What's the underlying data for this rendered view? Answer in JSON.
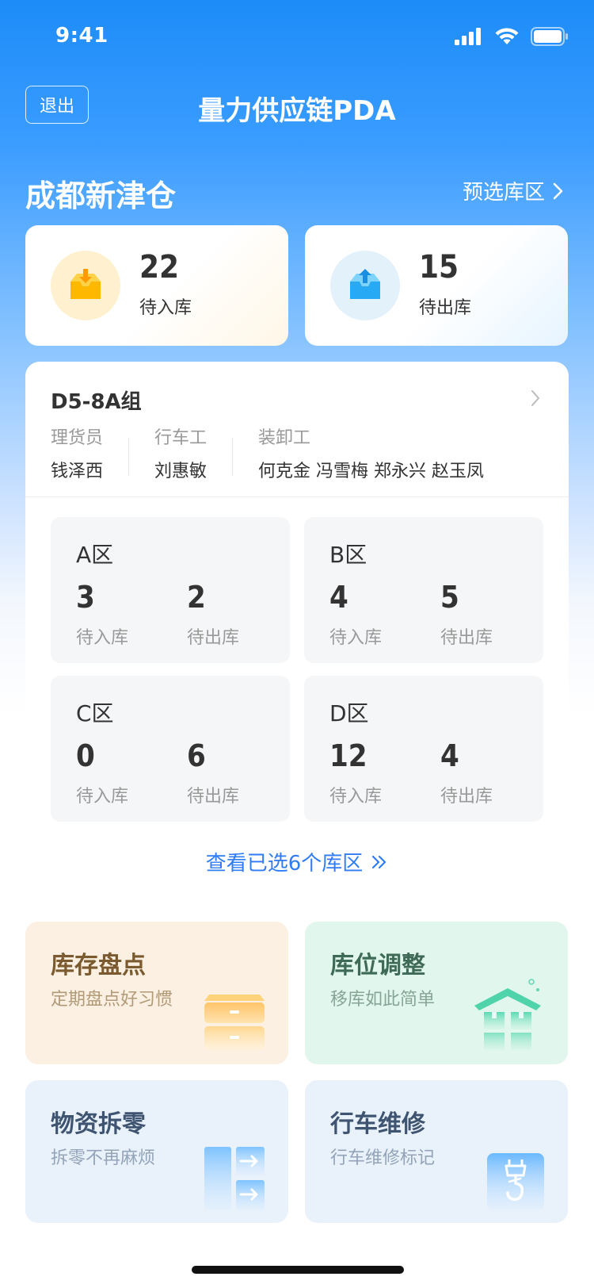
{
  "status_bar": {
    "time": "9:41"
  },
  "nav": {
    "exit_label": "退出",
    "title": "量力供应链PDA"
  },
  "warehouse": {
    "name": "成都新津仓",
    "preselect_label": "预选库区"
  },
  "summary": {
    "inbound": {
      "count": "22",
      "label": "待入库"
    },
    "outbound": {
      "count": "15",
      "label": "待出库"
    }
  },
  "group": {
    "title": "D5-8A组",
    "roles": [
      {
        "label": "理货员",
        "value": "钱泽西"
      },
      {
        "label": "行车工",
        "value": "刘惠敏"
      },
      {
        "label": "装卸工",
        "value": "何克金 冯雪梅 郑永兴 赵玉凤"
      }
    ],
    "zones": [
      {
        "name": "A区",
        "in": "3",
        "out": "2"
      },
      {
        "name": "B区",
        "in": "4",
        "out": "5"
      },
      {
        "name": "C区",
        "in": "0",
        "out": "6"
      },
      {
        "name": "D区",
        "in": "12",
        "out": "4"
      }
    ],
    "in_label": "待入库",
    "out_label": "待出库",
    "view_more": "查看已选6个库区"
  },
  "tiles": [
    {
      "title": "库存盘点",
      "subtitle": "定期盘点好习惯"
    },
    {
      "title": "库位调整",
      "subtitle": "移库如此简单"
    },
    {
      "title": "物资拆零",
      "subtitle": "拆零不再麻烦"
    },
    {
      "title": "行车维修",
      "subtitle": "行车维修标记"
    }
  ],
  "colors": {
    "primary": "#2f7cf6",
    "background_top": "#1d8cf8"
  },
  "icons": {
    "status": [
      "signal-icon",
      "wifi-icon",
      "battery-icon"
    ],
    "summary": [
      "inbox-in-icon",
      "inbox-out-icon"
    ],
    "tiles": [
      "drawer-cabinet-icon",
      "warehouse-icon",
      "split-icon",
      "crane-hook-icon"
    ]
  }
}
